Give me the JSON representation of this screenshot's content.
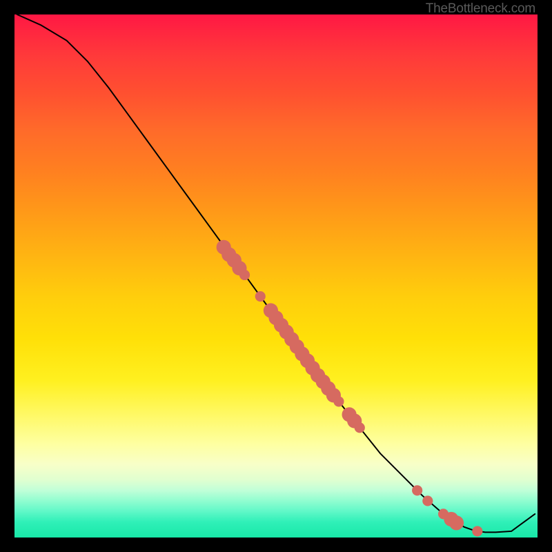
{
  "watermark": "TheBottleneck.com",
  "chart_data": {
    "type": "line",
    "title": "",
    "xlabel": "",
    "ylabel": "",
    "xlim": [
      0,
      100
    ],
    "ylim": [
      0,
      100
    ],
    "series": [
      {
        "name": "curve",
        "x": [
          0.5,
          5,
          10,
          14,
          18,
          22,
          26,
          30,
          34,
          38,
          42,
          46,
          50,
          54,
          58,
          62,
          66,
          70,
          74,
          78,
          82,
          86,
          88,
          90,
          92,
          95,
          99.5
        ],
        "y": [
          100,
          98,
          95,
          91,
          86,
          80.5,
          75,
          69.5,
          64,
          58.5,
          53,
          47.5,
          42,
          36.5,
          31,
          26,
          21,
          16,
          12,
          8,
          4.5,
          2,
          1.3,
          1,
          1,
          1.2,
          4.5
        ]
      }
    ],
    "markers": [
      {
        "x": 40,
        "y": 55.5,
        "r": 1.4
      },
      {
        "x": 41,
        "y": 54.1,
        "r": 1.4
      },
      {
        "x": 42,
        "y": 53,
        "r": 1.4
      },
      {
        "x": 43,
        "y": 51.5,
        "r": 1.4
      },
      {
        "x": 44,
        "y": 50.2,
        "r": 1.0
      },
      {
        "x": 47,
        "y": 46.1,
        "r": 1.0
      },
      {
        "x": 49,
        "y": 43.4,
        "r": 1.4
      },
      {
        "x": 50,
        "y": 42,
        "r": 1.4
      },
      {
        "x": 51,
        "y": 40.6,
        "r": 1.4
      },
      {
        "x": 52,
        "y": 39.3,
        "r": 1.4
      },
      {
        "x": 53,
        "y": 37.9,
        "r": 1.4
      },
      {
        "x": 54,
        "y": 36.5,
        "r": 1.4
      },
      {
        "x": 55,
        "y": 35.1,
        "r": 1.4
      },
      {
        "x": 56,
        "y": 33.8,
        "r": 1.4
      },
      {
        "x": 57,
        "y": 32.4,
        "r": 1.4
      },
      {
        "x": 58,
        "y": 31,
        "r": 1.4
      },
      {
        "x": 59,
        "y": 29.8,
        "r": 1.4
      },
      {
        "x": 60,
        "y": 28.5,
        "r": 1.4
      },
      {
        "x": 61,
        "y": 27.2,
        "r": 1.4
      },
      {
        "x": 62,
        "y": 26,
        "r": 1.0
      },
      {
        "x": 64,
        "y": 23.5,
        "r": 1.4
      },
      {
        "x": 65,
        "y": 22.3,
        "r": 1.4
      },
      {
        "x": 66,
        "y": 21,
        "r": 1.0
      },
      {
        "x": 77,
        "y": 9,
        "r": 1.0
      },
      {
        "x": 79,
        "y": 7,
        "r": 1.0
      },
      {
        "x": 82,
        "y": 4.5,
        "r": 1.0
      },
      {
        "x": 83.5,
        "y": 3.5,
        "r": 1.4
      },
      {
        "x": 84.5,
        "y": 2.8,
        "r": 1.4
      },
      {
        "x": 88.5,
        "y": 1.2,
        "r": 1.0
      }
    ],
    "marker_color": "#d66a60"
  }
}
